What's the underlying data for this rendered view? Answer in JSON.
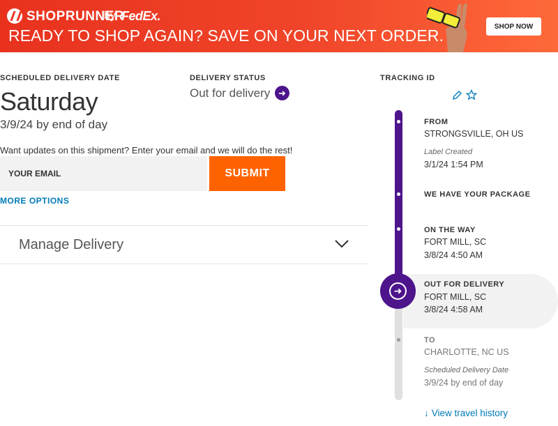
{
  "banner": {
    "brand": "SHOPRUNNER",
    "by": "by",
    "fedex": "FedEx.",
    "headline": "READY TO SHOP AGAIN? SAVE ON YOUR NEXT ORDER.",
    "shop_now": "SHOP NOW"
  },
  "delivery": {
    "scheduled_label": "SCHEDULED DELIVERY DATE",
    "day": "Saturday",
    "date": "3/9/24 by end of day",
    "status_label": "DELIVERY STATUS",
    "status": "Out for delivery"
  },
  "updates": {
    "prompt": "Want updates on this shipment? Enter your email and we will do the rest!",
    "email_placeholder": "YOUR EMAIL",
    "submit": "SUBMIT",
    "more_options": "MORE OPTIONS"
  },
  "manage": {
    "label": "Manage Delivery"
  },
  "tracking": {
    "label": "TRACKING ID",
    "events": [
      {
        "title": "FROM",
        "location": "STRONGSVILLE, OH US",
        "note": "Label Created",
        "time": "3/1/24 1:54 PM"
      },
      {
        "title": "WE HAVE YOUR PACKAGE"
      },
      {
        "title": "ON THE WAY",
        "location": "FORT MILL, SC",
        "time": "3/8/24 4:50 AM"
      },
      {
        "title": "OUT FOR DELIVERY",
        "location": "FORT MILL, SC",
        "time": "3/8/24 4:58 AM"
      },
      {
        "title": "TO",
        "location": "CHARLOTTE, NC US",
        "note": "Scheduled Delivery Date",
        "time": "3/9/24 by end of day"
      }
    ],
    "view_history": "View travel history"
  },
  "colors": {
    "purple": "#4d148c",
    "orange": "#ff6200",
    "link": "#007ab7",
    "banner": "#e8321e"
  }
}
